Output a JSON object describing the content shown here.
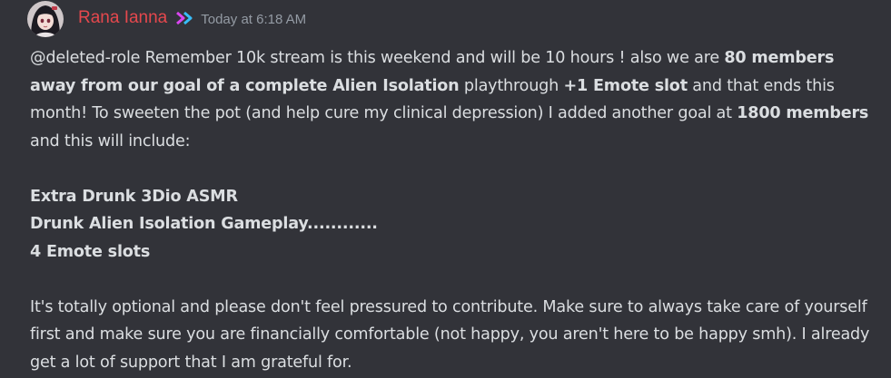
{
  "message": {
    "author": "Rana Ianna",
    "timestamp": "Today at 6:18 AM",
    "author_color": "#e5484d",
    "role_icon": "double-chevron-icon",
    "avatar_icon": "user-avatar-icon",
    "paragraph1": {
      "s1": "@deleted-role Remember 10k stream is this weekend and will be 10 hours ! also we are ",
      "b1": "80 members away from our goal of a complete Alien Isolation",
      "s2": " playthrough ",
      "b2": "+1 Emote slot",
      "s3": " and that ends this month! To sweeten the pot (and help cure my clinical depression) I added another goal at ",
      "b3": "1800 members",
      "s4": " and this will include:"
    },
    "goals": [
      "Extra Drunk 3Dio ASMR",
      "Drunk Alien Isolation Gameplay............",
      "4 Emote slots"
    ],
    "paragraph3": "It's totally optional and please don't feel pressured to contribute. Make sure to always take care of yourself first and make sure you are financially comfortable (not happy, you aren't here to be happy smh). I already get a lot of support that I am grateful for."
  }
}
